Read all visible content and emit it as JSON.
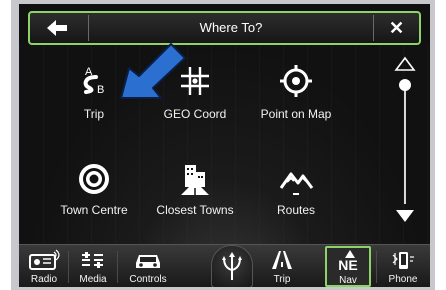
{
  "header": {
    "title": "Where To?",
    "back_icon": "back-arrow-icon",
    "close_label": "✕"
  },
  "items": [
    {
      "label": "Trip",
      "icon": "trip-ab-icon"
    },
    {
      "label": "GEO Coord",
      "icon": "geo-coord-icon"
    },
    {
      "label": "Point on Map",
      "icon": "crosshair-icon"
    },
    {
      "label": "Town Centre",
      "icon": "target-icon"
    },
    {
      "label": "Closest Towns",
      "icon": "buildings-icon"
    },
    {
      "label": "Routes",
      "icon": "mountains-icon"
    }
  ],
  "trip_icon_letters": {
    "a": "A",
    "b": "B"
  },
  "nav": {
    "items": [
      {
        "label": "Radio",
        "icon": "radio-icon"
      },
      {
        "label": "Media",
        "icon": "media-icon"
      },
      {
        "label": "Controls",
        "icon": "car-icon"
      },
      {
        "label": "Trip",
        "icon": "road-icon"
      },
      {
        "label": "Nav",
        "icon": "compass-icon",
        "heading": "NE",
        "active": true
      },
      {
        "label": "Phone",
        "icon": "phone-icon"
      }
    ]
  },
  "colors": {
    "accent": "#8ed36a",
    "background": "#101010",
    "text": "#ffffff",
    "pointer": "#2b6fd1"
  }
}
